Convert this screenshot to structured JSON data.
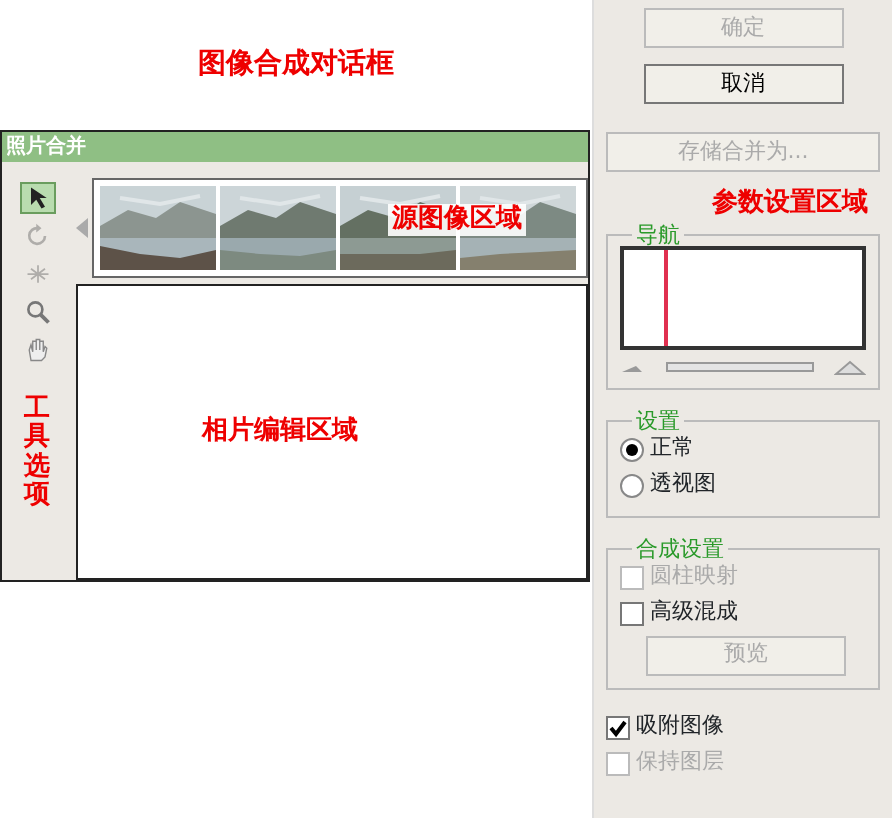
{
  "annotations": {
    "title": "图像合成对话框",
    "source_area": "源图像区域",
    "edit_area": "相片编辑区域",
    "tool_options": "工具选项",
    "params_area": "参数设置区域"
  },
  "dialog": {
    "title": "照片合并"
  },
  "tools": [
    {
      "kind": "select",
      "selected": true,
      "disabled": false
    },
    {
      "kind": "rotate",
      "selected": false,
      "disabled": true
    },
    {
      "kind": "vanish",
      "selected": false,
      "disabled": true
    },
    {
      "kind": "zoom",
      "selected": false,
      "disabled": false
    },
    {
      "kind": "hand",
      "selected": false,
      "disabled": false
    }
  ],
  "buttons": [
    {
      "label": "确定",
      "disabled": true
    },
    {
      "label": "取消",
      "disabled": false
    }
  ],
  "save_as": {
    "label": "存储合并为...",
    "disabled": true
  },
  "navigator": {
    "legend": "导航",
    "level": 0
  },
  "settings": {
    "legend": "设置",
    "options": [
      {
        "label": "正常",
        "selected": true
      },
      {
        "label": "透视图",
        "selected": false
      }
    ]
  },
  "blend": {
    "legend": "合成设置",
    "options": [
      {
        "label": "圆柱映射",
        "checked": false,
        "disabled": true
      },
      {
        "label": "高级混成",
        "checked": false,
        "disabled": false
      }
    ],
    "preview": {
      "label": "预览",
      "disabled": true
    }
  },
  "bottom_options": [
    {
      "label": "吸附图像",
      "checked": true,
      "disabled": false
    },
    {
      "label": "保持图层",
      "checked": false,
      "disabled": true
    }
  ]
}
